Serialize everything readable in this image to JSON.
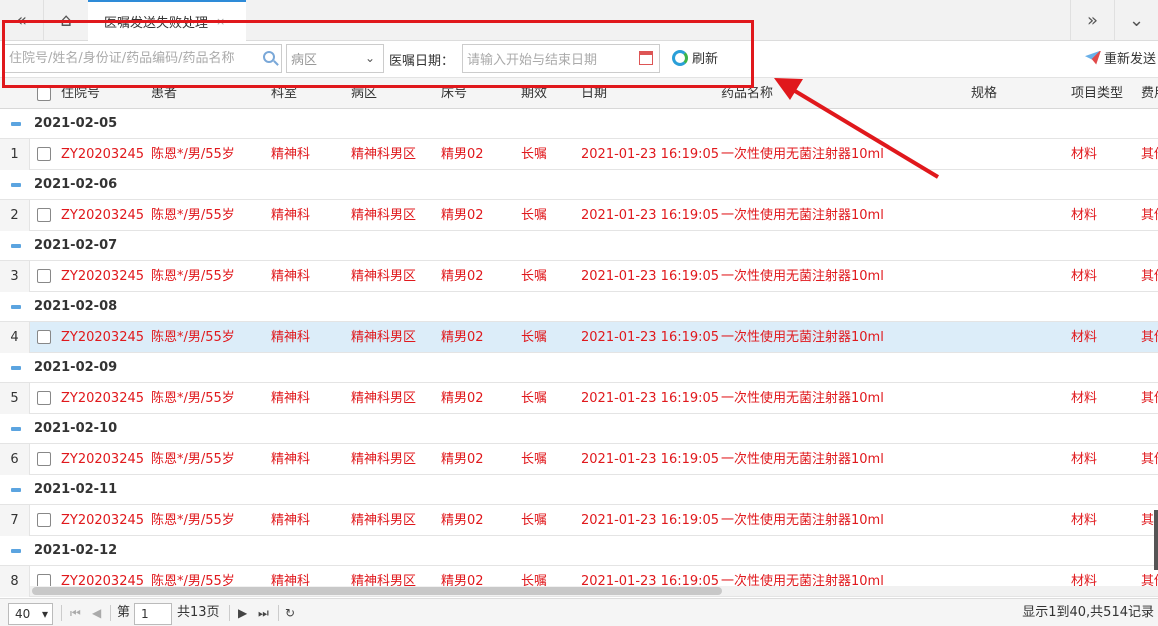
{
  "tabs": {
    "active_label": "医嘱发送失败处理",
    "close_glyph": "×"
  },
  "toolbar": {
    "search_placeholder": "住院号/姓名/身份证/药品编码/药品名称",
    "ward_select": "病区",
    "date_label": "医嘱日期：",
    "date_placeholder": "请输入开始与结束日期",
    "refresh_label": "刷新",
    "resend_label": "重新发送"
  },
  "columns": [
    "住院号",
    "患者",
    "科室",
    "病区",
    "床号",
    "期效",
    "日期",
    "药品名称",
    "规格",
    "项目类型",
    "费用"
  ],
  "groups": [
    {
      "date": "2021-02-05",
      "row": {
        "num": "1",
        "id": "ZY20203245",
        "patient": "陈恩*/男/55岁",
        "dept": "精神科",
        "ward": "精神科男区",
        "bed": "精男02",
        "period": "长嘱",
        "date": "2021-01-23 16:19:05",
        "drug": "一次性使用无菌注射器10ml",
        "spec": "",
        "type": "材料",
        "fee": "其他"
      }
    },
    {
      "date": "2021-02-06",
      "row": {
        "num": "2",
        "id": "ZY20203245",
        "patient": "陈恩*/男/55岁",
        "dept": "精神科",
        "ward": "精神科男区",
        "bed": "精男02",
        "period": "长嘱",
        "date": "2021-01-23 16:19:05",
        "drug": "一次性使用无菌注射器10ml",
        "spec": "",
        "type": "材料",
        "fee": "其他"
      }
    },
    {
      "date": "2021-02-07",
      "row": {
        "num": "3",
        "id": "ZY20203245",
        "patient": "陈恩*/男/55岁",
        "dept": "精神科",
        "ward": "精神科男区",
        "bed": "精男02",
        "period": "长嘱",
        "date": "2021-01-23 16:19:05",
        "drug": "一次性使用无菌注射器10ml",
        "spec": "",
        "type": "材料",
        "fee": "其他"
      }
    },
    {
      "date": "2021-02-08",
      "row": {
        "num": "4",
        "id": "ZY20203245",
        "patient": "陈恩*/男/55岁",
        "dept": "精神科",
        "ward": "精神科男区",
        "bed": "精男02",
        "period": "长嘱",
        "date": "2021-01-23 16:19:05",
        "drug": "一次性使用无菌注射器10ml",
        "spec": "",
        "type": "材料",
        "fee": "其他"
      }
    },
    {
      "date": "2021-02-09",
      "row": {
        "num": "5",
        "id": "ZY20203245",
        "patient": "陈恩*/男/55岁",
        "dept": "精神科",
        "ward": "精神科男区",
        "bed": "精男02",
        "period": "长嘱",
        "date": "2021-01-23 16:19:05",
        "drug": "一次性使用无菌注射器10ml",
        "spec": "",
        "type": "材料",
        "fee": "其他"
      }
    },
    {
      "date": "2021-02-10",
      "row": {
        "num": "6",
        "id": "ZY20203245",
        "patient": "陈恩*/男/55岁",
        "dept": "精神科",
        "ward": "精神科男区",
        "bed": "精男02",
        "period": "长嘱",
        "date": "2021-01-23 16:19:05",
        "drug": "一次性使用无菌注射器10ml",
        "spec": "",
        "type": "材料",
        "fee": "其他"
      }
    },
    {
      "date": "2021-02-11",
      "row": {
        "num": "7",
        "id": "ZY20203245",
        "patient": "陈恩*/男/55岁",
        "dept": "精神科",
        "ward": "精神科男区",
        "bed": "精男02",
        "period": "长嘱",
        "date": "2021-01-23 16:19:05",
        "drug": "一次性使用无菌注射器10ml",
        "spec": "",
        "type": "材料",
        "fee": "其他"
      }
    },
    {
      "date": "2021-02-12",
      "row": {
        "num": "8",
        "id": "ZY20203245",
        "patient": "陈恩*/男/55岁",
        "dept": "精神科",
        "ward": "精神科男区",
        "bed": "精男02",
        "period": "长嘱",
        "date": "2021-01-23 16:19:05",
        "drug": "一次性使用无菌注射器10ml",
        "spec": "",
        "type": "材料",
        "fee": "其他"
      }
    }
  ],
  "selected_row": "4",
  "pager": {
    "page_size": "40",
    "page_prefix": "第",
    "page_value": "1",
    "page_total": "共13页",
    "info": "显示1到40,共514记录"
  },
  "colors": {
    "accent": "#2e8bd8",
    "row_text": "#e0181c",
    "selected_row": "#dcedf9",
    "annotation": "#e0181c"
  }
}
